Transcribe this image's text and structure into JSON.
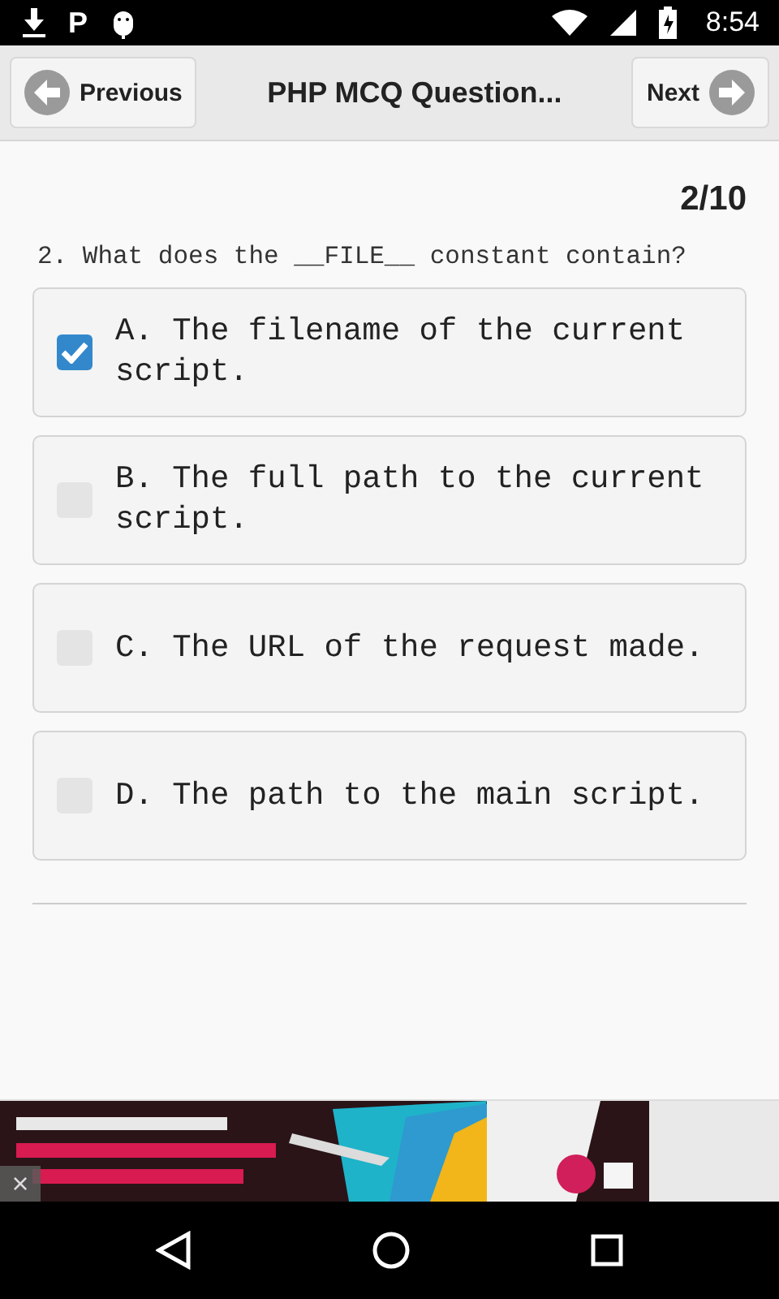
{
  "status_bar": {
    "time": "8:54",
    "notification_letter": "P"
  },
  "header": {
    "previous": "Previous",
    "title": "PHP MCQ Question...",
    "next": "Next"
  },
  "counter": "2/10",
  "question": "2. What does the __FILE__ constant contain?",
  "options": [
    {
      "text": "A. The filename of the current script.",
      "checked": true
    },
    {
      "text": "B. The full path to the current script.",
      "checked": false
    },
    {
      "text": "C. The URL of the request made.",
      "checked": false
    },
    {
      "text": "D. The path to the main script.",
      "checked": false
    }
  ],
  "ad": {
    "kind": "picture",
    "close": "×"
  }
}
